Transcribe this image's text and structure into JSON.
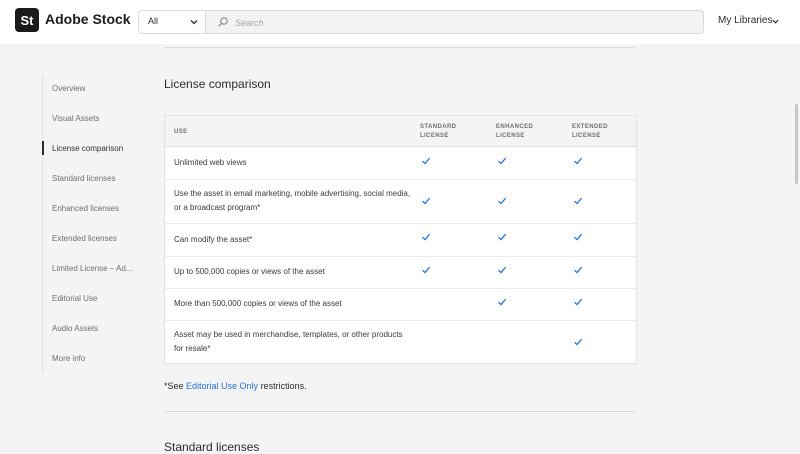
{
  "header": {
    "logo_text": "St",
    "brand": "Adobe Stock",
    "filter_value": "All",
    "search_placeholder": "Search",
    "libraries": "My Libraries"
  },
  "sidebar": {
    "items": [
      {
        "label": "Overview",
        "active": false
      },
      {
        "label": "Visual Assets",
        "active": false
      },
      {
        "label": "License comparison",
        "active": true
      },
      {
        "label": "Standard licenses",
        "active": false
      },
      {
        "label": "Enhanced licenses",
        "active": false
      },
      {
        "label": "Extended licenses",
        "active": false
      },
      {
        "label": "Limited License – Ad...",
        "active": false
      },
      {
        "label": "Editorial Use",
        "active": false
      },
      {
        "label": "Audio Assets",
        "active": false
      },
      {
        "label": "More info",
        "active": false
      }
    ]
  },
  "main": {
    "section_title": "License comparison",
    "table": {
      "headers": {
        "use": "USE",
        "standard": "STANDARD\nLICENSE",
        "enhanced": "ENHANCED\nLICENSE",
        "extended": "EXTENDED\nLICENSE"
      },
      "rows": [
        {
          "use": "Unlimited web views",
          "standard": true,
          "enhanced": true,
          "extended": true
        },
        {
          "use": "Use the asset in email marketing, mobile advertising, social media, or a broadcast program*",
          "standard": true,
          "enhanced": true,
          "extended": true
        },
        {
          "use": "Can modify the asset*",
          "standard": true,
          "enhanced": true,
          "extended": true
        },
        {
          "use": "Up to 500,000 copies or views of the asset",
          "standard": true,
          "enhanced": true,
          "extended": true
        },
        {
          "use": "More than 500,000 copies or views of the asset",
          "standard": false,
          "enhanced": true,
          "extended": true
        },
        {
          "use": "Asset may be used in merchandise, templates, or other products for resale*",
          "standard": false,
          "enhanced": false,
          "extended": true
        }
      ]
    },
    "footnote": {
      "prefix": "*See ",
      "link": "Editorial Use Only",
      "suffix": " restrictions."
    },
    "next_section_title": "Standard licenses"
  },
  "colors": {
    "check": "#2b73d8",
    "link": "#2b73d8"
  }
}
